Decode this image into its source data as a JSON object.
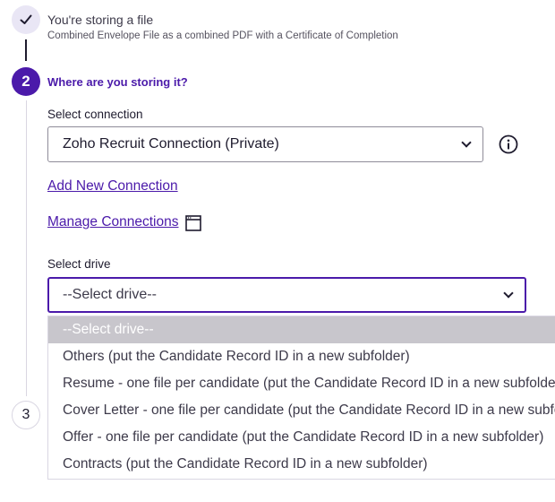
{
  "steps": [
    {
      "number": "",
      "title": "You're storing a file",
      "subtitle": "Combined Envelope File as a combined PDF with a Certificate of Completion",
      "state": "complete"
    },
    {
      "number": "2",
      "title": "Where are you storing it?",
      "state": "active"
    },
    {
      "number": "3",
      "state": "upcoming"
    }
  ],
  "connection": {
    "label": "Select connection",
    "selected": "Zoho Recruit Connection (Private)",
    "add_link": "Add New Connection",
    "manage_link": "Manage Connections"
  },
  "drive": {
    "label": "Select drive",
    "selected": "--Select drive--",
    "options": [
      "--Select drive--",
      "Others (put the Candidate Record ID in a new subfolder)",
      "Resume - one file per candidate (put the Candidate Record ID in a new subfolder)",
      "Cover Letter - one file per candidate (put the Candidate Record ID in a new subfolder)",
      "Offer - one file per candidate (put the Candidate Record ID in a new subfolder)",
      "Contracts (put the Candidate Record ID in a new subfolder)"
    ]
  },
  "colors": {
    "accent": "#4b1aaa",
    "text": "#1e1b2e",
    "highlight": "#c8c6cc"
  },
  "icons": {
    "step1": "checkmark-icon",
    "info": "info-icon",
    "manage": "window-icon",
    "dropdown": "chevron-down-icon"
  }
}
